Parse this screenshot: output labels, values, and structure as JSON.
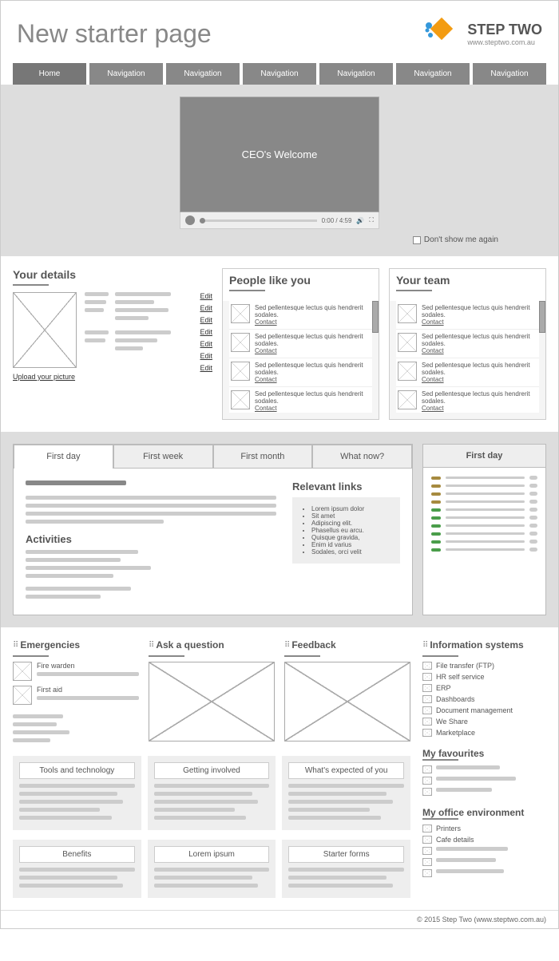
{
  "header": {
    "title": "New starter page",
    "brand": "STEP TWO",
    "brand_url": "www.steptwo.com.au"
  },
  "nav": [
    "Home",
    "Navigation",
    "Navigation",
    "Navigation",
    "Navigation",
    "Navigation",
    "Navigation"
  ],
  "video": {
    "title": "CEO's Welcome",
    "time": "0:00 / 4:59",
    "dont_show": "Don't show me again"
  },
  "details": {
    "title": "Your details",
    "upload": "Upload your picture",
    "edit": "Edit"
  },
  "people": {
    "title": "People like you",
    "item_text": "Sed pellentesque lectus quis hendrerit sodales.",
    "contact": "Contact"
  },
  "team": {
    "title": "Your team"
  },
  "tabs": {
    "items": [
      "First day",
      "First week",
      "First month",
      "What now?"
    ],
    "rel_title": "Relevant links",
    "rel_items": [
      "Lorem ipsum dolor",
      "Sit amet",
      "Adipiscing elit.",
      "Phasellus eu arcu.",
      "Quisque gravida,",
      "Enim id varius",
      "Sodales, orci velit"
    ],
    "act_title": "Activities",
    "side_title": "First day"
  },
  "widgets": {
    "emergencies": "Emergencies",
    "fire": "Fire warden",
    "firstaid": "First aid",
    "ask": "Ask a question",
    "feedback": "Feedback",
    "info": "Information systems",
    "info_items": [
      "File transfer (FTP)",
      "HR self service",
      "ERP",
      "Dashboards",
      "Document management",
      "We Share",
      "Marketplace"
    ],
    "fav": "My favourites",
    "env": "My office environment",
    "env_items": [
      "Printers",
      "Cafe details"
    ],
    "cards1": [
      "Tools and technology",
      "Getting involved",
      "What's expected of you"
    ],
    "cards2": [
      "Benefits",
      "Lorem ipsum",
      "Starter forms"
    ]
  },
  "footer": "© 2015 Step Two (www.steptwo.com.au)"
}
